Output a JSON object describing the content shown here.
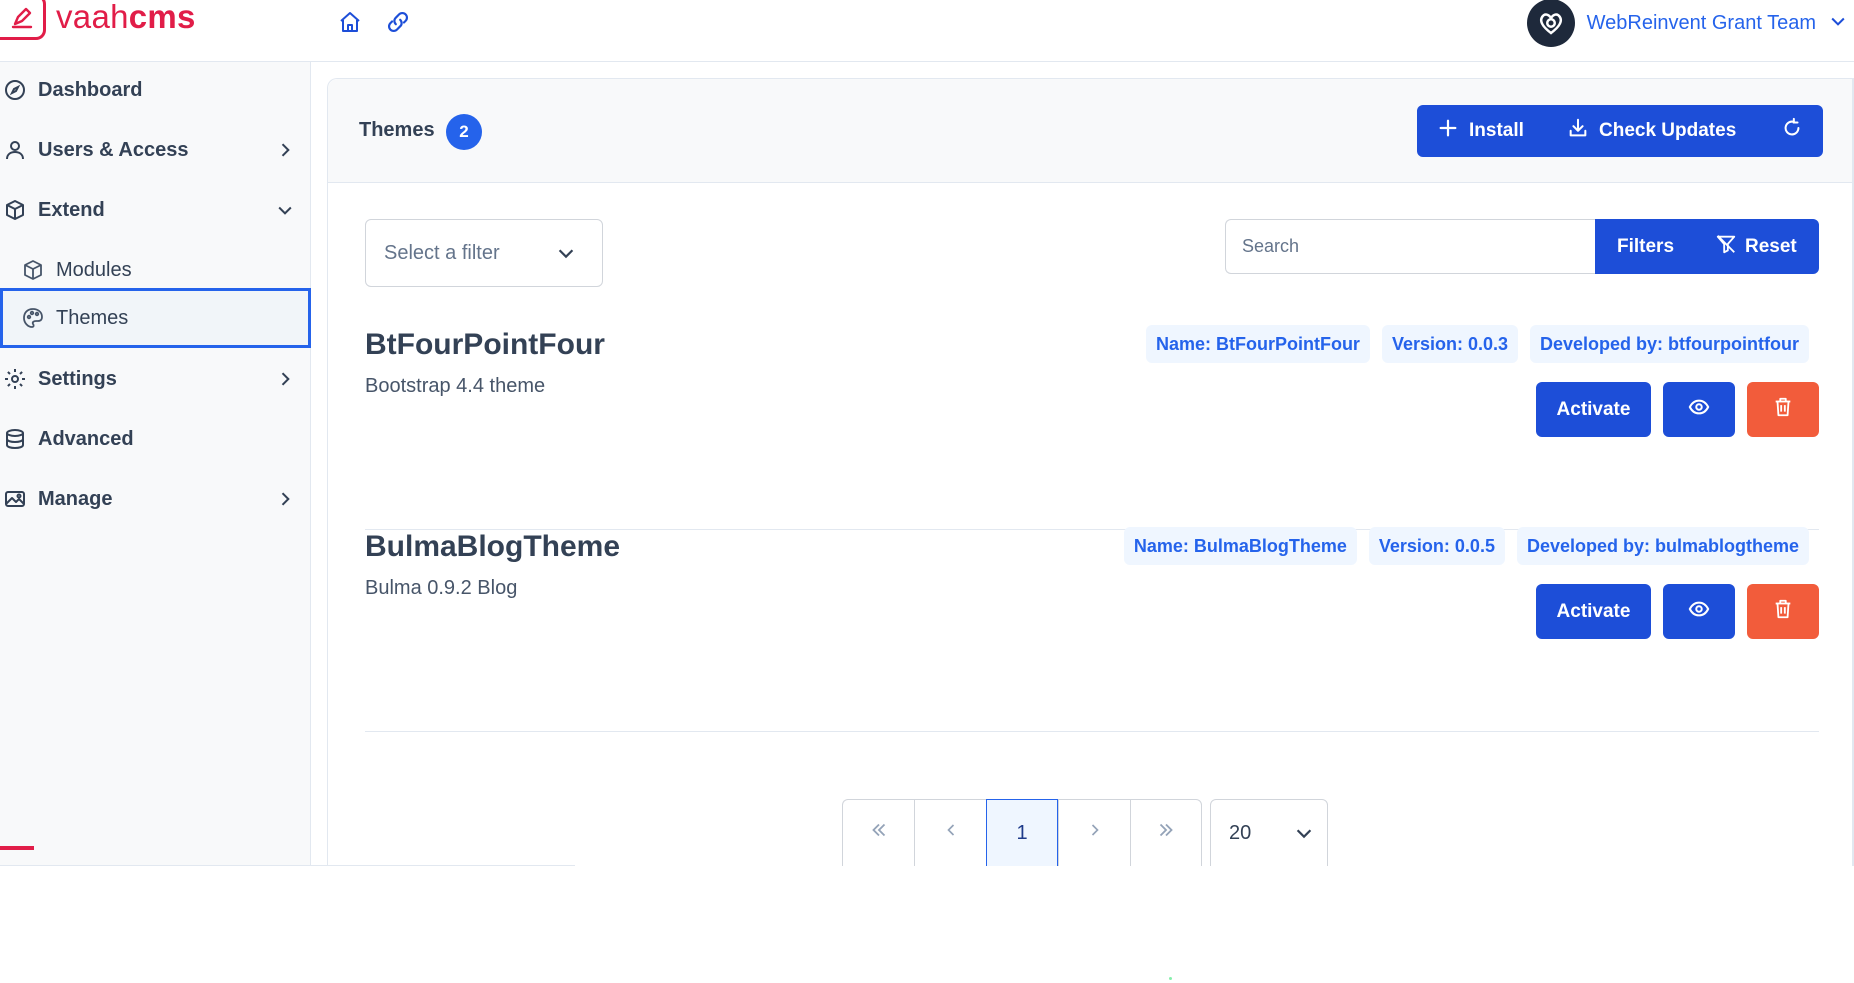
{
  "app": {
    "logo_light": "vaah",
    "logo_bold": "cms",
    "brand_color": "#e11d48",
    "accent_color": "#1d4ed8"
  },
  "topbar": {
    "icons": [
      "home-icon",
      "link-icon"
    ],
    "user_name": "WebReinvent Grant Team"
  },
  "sidebar": {
    "items": [
      {
        "label": "Dashboard",
        "icon": "compass-icon"
      },
      {
        "label": "Users & Access",
        "icon": "user-icon",
        "chevron": "right"
      },
      {
        "label": "Extend",
        "icon": "box-icon",
        "chevron": "down"
      },
      {
        "label": "Modules",
        "icon": "box-icon",
        "sub": true
      },
      {
        "label": "Themes",
        "icon": "palette-icon",
        "sub": true,
        "active": true
      },
      {
        "label": "Settings",
        "icon": "cog-icon",
        "chevron": "right"
      },
      {
        "label": "Advanced",
        "icon": "database-icon"
      },
      {
        "label": "Manage",
        "icon": "images-icon",
        "chevron": "right"
      }
    ]
  },
  "header": {
    "title": "Themes",
    "count": "2",
    "install_label": "Install",
    "check_updates_label": "Check Updates"
  },
  "filters": {
    "select_placeholder": "Select a filter",
    "search_placeholder": "Search",
    "filters_label": "Filters",
    "reset_label": "Reset"
  },
  "themes": [
    {
      "name": "BtFourPointFour",
      "description": "Bootstrap 4.4 theme",
      "tag_name": "Name: BtFourPointFour",
      "tag_version": "Version: 0.0.3",
      "tag_developer": "Developed by: btfourpointfour",
      "activate_label": "Activate"
    },
    {
      "name": "BulmaBlogTheme",
      "description": "Bulma 0.9.2 Blog",
      "tag_name": "Name: BulmaBlogTheme",
      "tag_version": "Version: 0.0.5",
      "tag_developer": "Developed by: bulmablogtheme",
      "activate_label": "Activate"
    }
  ],
  "pagination": {
    "current_page": "1",
    "per_page": "20"
  }
}
